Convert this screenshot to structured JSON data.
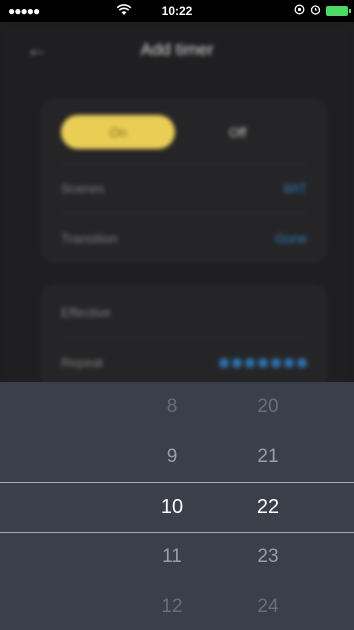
{
  "status_bar": {
    "signal": "●●●●●",
    "time": "10:22",
    "icons": [
      "wifi-icon",
      "location-icon",
      "alarm-icon",
      "battery-icon"
    ]
  },
  "header": {
    "back_icon": "back-arrow-icon",
    "title": "Add timer"
  },
  "power_toggle": {
    "on_label": "On",
    "off_label": "Off",
    "selected": "On"
  },
  "settings": {
    "scenes_label": "Scenes",
    "scenes_value": "WIT",
    "transition_label": "Transition",
    "transition_value": "Gone"
  },
  "schedule": {
    "effective_label": "Effective",
    "repeat_label": "Repeat"
  },
  "time_picker": {
    "hours": [
      "8",
      "9",
      "10",
      "11",
      "12"
    ],
    "minutes": [
      "20",
      "21",
      "22",
      "23",
      "24"
    ],
    "selected_hour": "10",
    "selected_minute": "22"
  },
  "colors": {
    "accent_yellow": "#e9cd55",
    "accent_blue": "#2e7db8",
    "picker_bg": "#3b3f49",
    "battery_green": "#4cd964"
  }
}
